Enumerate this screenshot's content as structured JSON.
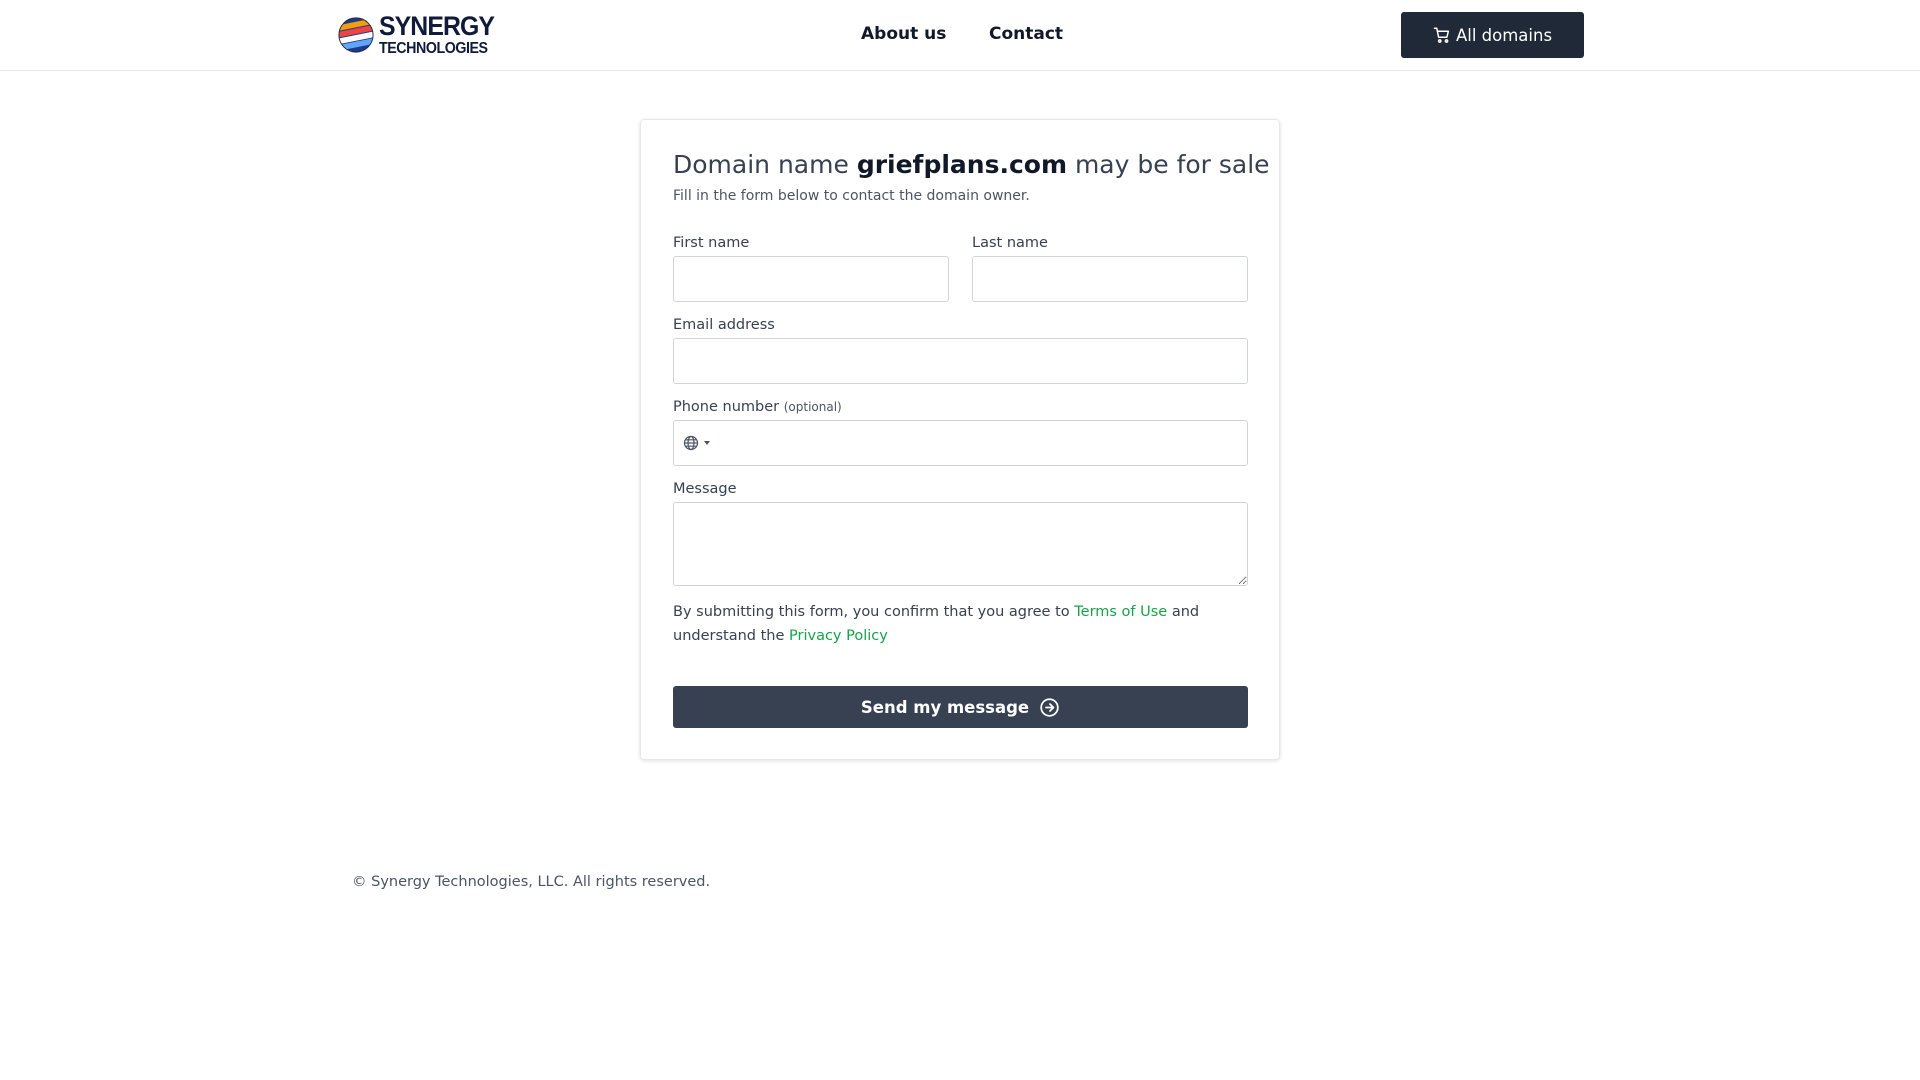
{
  "header": {
    "brand_line1": "SYNERGY",
    "brand_line2": "TECHNOLOGIES",
    "nav": [
      "About us",
      "Contact"
    ],
    "cta_label": "All domains",
    "cta_icon": "cart-icon"
  },
  "form": {
    "title_prefix": "Domain name",
    "domain": "griefplans.com",
    "title_suffix": "may be for sale",
    "subtitle": "Fill in the form below to contact the domain owner.",
    "first_name": {
      "label": "First name",
      "value": ""
    },
    "last_name": {
      "label": "Last name",
      "value": ""
    },
    "email": {
      "label": "Email address",
      "value": ""
    },
    "phone": {
      "label": "Phone number",
      "optional": "(optional)",
      "value": "",
      "flag_icon": "globe-icon"
    },
    "message": {
      "label": "Message",
      "value": ""
    },
    "consent_pre": "By submitting this form, you confirm that you agree to",
    "terms_link": "Terms of Use",
    "consent_mid": "and understand the",
    "privacy_link": "Privacy Policy",
    "submit_label": "Send my message",
    "submit_icon": "arrow-right-circle-icon"
  },
  "footer": {
    "copyright": "© Synergy Technologies, LLC. All rights reserved."
  },
  "colors": {
    "dark_button": "#1f2937",
    "submit_button": "#374151",
    "link_green": "#16a34a"
  }
}
